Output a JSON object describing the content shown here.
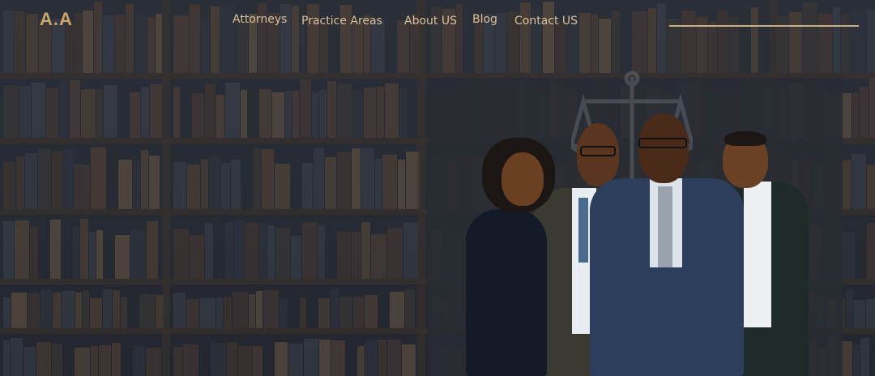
{
  "brand": {
    "logo": "A.A"
  },
  "nav": {
    "items": [
      {
        "label": "Attorneys"
      },
      {
        "label": "Practice Areas"
      },
      {
        "label": "About US"
      },
      {
        "label": "Blog"
      },
      {
        "label": "Contact US"
      }
    ]
  },
  "search": {
    "placeholder": ""
  },
  "colors": {
    "accent": "#c9a56c",
    "nav_text": "#d9c29a",
    "background": "#262a33"
  },
  "hero": {
    "image": "four-attorneys-photo",
    "background": "bookshelf-with-scales-of-justice"
  }
}
